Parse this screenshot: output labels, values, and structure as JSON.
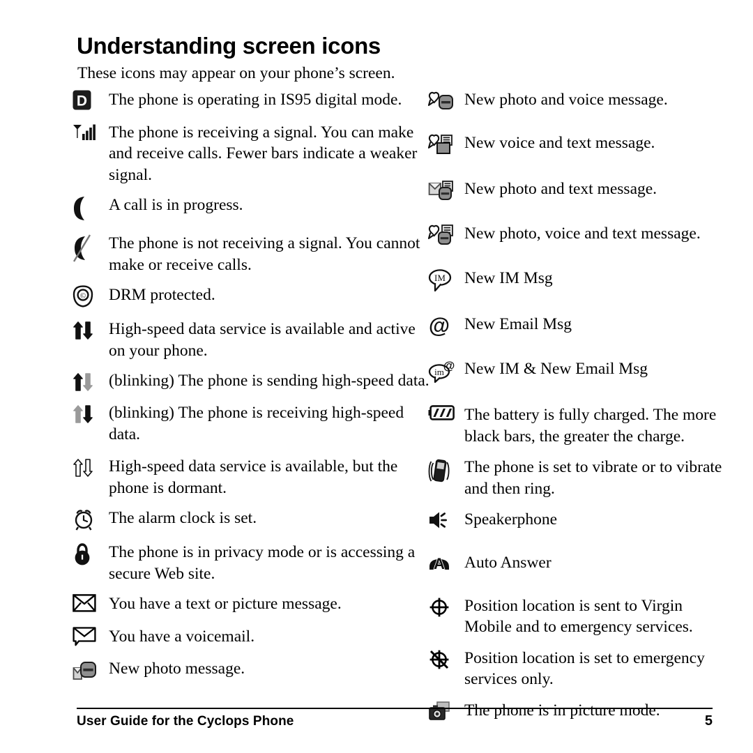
{
  "document": {
    "title": "Understanding screen icons",
    "intro": "These icons may appear on your phone’s screen."
  },
  "footer": {
    "text": "User Guide for the Cyclops Phone",
    "page_number": "5"
  },
  "colors": {
    "ink": "#000000",
    "paper": "#ffffff",
    "gray": "#9a9a9a",
    "mid_gray": "#6e6e6e",
    "light_gray": "#c9c9c9"
  },
  "left_column": [
    {
      "icon": "digital-mode-d-icon",
      "text": "The phone is operating in IS95 digital mode.",
      "lines": 1
    },
    {
      "icon": "signal-strength-icon",
      "text": "The phone is receiving a signal. You can make and receive calls. Fewer bars indicate a weaker signal.",
      "lines": 2
    },
    {
      "icon": "call-in-progress-icon",
      "text": "A call is in progress.",
      "lines": 1
    },
    {
      "icon": "no-signal-icon",
      "text": "The phone is not receiving a signal. You cannot make or receive calls.",
      "lines": 2
    },
    {
      "icon": "drm-protected-icon",
      "text": "DRM protected.",
      "lines": 1
    },
    {
      "icon": "highspeed-active-icon",
      "text": "High-speed data service is available and active on your phone.",
      "lines": 2
    },
    {
      "icon": "highspeed-sending-icon",
      "text": "(blinking) The phone is sending high-speed data.",
      "lines": 2
    },
    {
      "icon": "highspeed-receiving-icon",
      "text": "(blinking) The phone is receiving high-speed data.",
      "lines": 1
    },
    {
      "icon": "highspeed-dormant-icon",
      "text": "High-speed data service is available, but the phone is dormant.",
      "lines": 2
    },
    {
      "icon": "alarm-clock-icon",
      "text": "The alarm clock is set.",
      "lines": 1
    },
    {
      "icon": "privacy-lock-icon",
      "text": "The phone is in privacy mode or is accessing a secure Web site.",
      "lines": 2
    },
    {
      "icon": "text-message-icon",
      "text": "You have a text or picture message.",
      "lines": 1
    },
    {
      "icon": "voicemail-icon",
      "text": "You have a voicemail.",
      "lines": 1
    },
    {
      "icon": "new-photo-message-icon",
      "text": "New photo message.",
      "lines": 1
    }
  ],
  "right_column": [
    {
      "icon": "photo-voice-message-icon",
      "text": "New photo and voice message.",
      "lines": 1
    },
    {
      "icon": "voice-text-message-icon",
      "text": "New voice and text message.",
      "lines": 1
    },
    {
      "icon": "photo-text-message-icon",
      "text": "New photo and text message.",
      "lines": 1
    },
    {
      "icon": "photo-voice-text-message-icon",
      "text": "New photo, voice and text message.",
      "lines": 1
    },
    {
      "icon": "new-im-icon",
      "text": "New IM Msg",
      "lines": 1
    },
    {
      "icon": "new-email-icon",
      "text": "New Email Msg",
      "lines": 1
    },
    {
      "icon": "new-im-email-icon",
      "text": "New IM & New Email Msg",
      "lines": 1
    },
    {
      "icon": "battery-full-icon",
      "text": "The battery is fully charged. The more black bars, the greater the charge.",
      "lines": 2
    },
    {
      "icon": "vibrate-icon",
      "text": "The phone is set to vibrate or to vibrate and then ring.",
      "lines": 2
    },
    {
      "icon": "speakerphone-icon",
      "text": "Speakerphone",
      "lines": 1
    },
    {
      "icon": "auto-answer-icon",
      "text": "Auto Answer",
      "lines": 1
    },
    {
      "icon": "position-location-on-icon",
      "text": "Position location is sent to Virgin Mobile and to emergency services.",
      "lines": 2
    },
    {
      "icon": "position-location-911-icon",
      "text": "Position location is set to emergency services only.",
      "lines": 2
    },
    {
      "icon": "picture-mode-icon",
      "text": "The phone is in picture mode.",
      "lines": 1
    }
  ],
  "icon_glyph_labels": {
    "digital-mode-d-icon": "D",
    "new-im-icon": "IM",
    "new-email-icon": "@",
    "new-im-email-icon": "im",
    "auto-answer-icon": "A"
  }
}
